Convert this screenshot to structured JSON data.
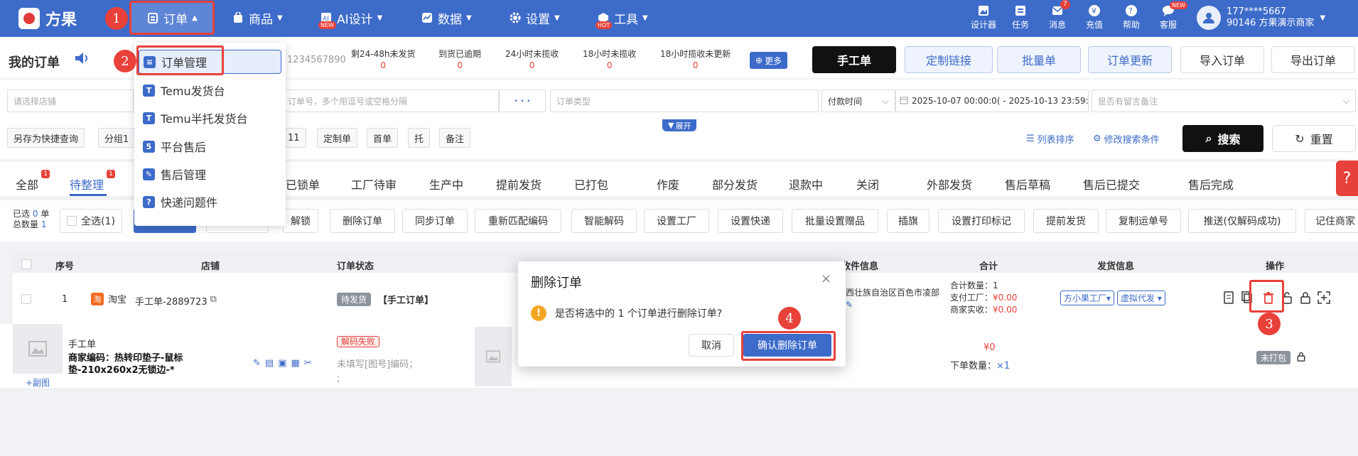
{
  "topnav": {
    "logo_text": "方果",
    "items": [
      {
        "label": "订单",
        "icon": "clipboard-icon"
      },
      {
        "label": "商品",
        "icon": "bag-icon"
      },
      {
        "label": "AI设计",
        "icon": "ai-icon",
        "badge": "NEW"
      },
      {
        "label": "数据",
        "icon": "chart-icon"
      },
      {
        "label": "设置",
        "icon": "gear-icon"
      },
      {
        "label": "工具",
        "icon": "toolbox-icon",
        "badge": "HOT"
      }
    ],
    "right_tools": [
      {
        "label": "设计器",
        "icon": "image-icon"
      },
      {
        "label": "任务",
        "icon": "task-icon"
      },
      {
        "label": "消息",
        "icon": "bell-icon",
        "count": "7"
      },
      {
        "label": "充值",
        "icon": "yen-icon"
      },
      {
        "label": "帮助",
        "icon": "help-icon"
      },
      {
        "label": "客服",
        "icon": "chat-icon",
        "badge": "NEW"
      }
    ],
    "user_phone": "177****5667",
    "user_shop": "90146 方果演示商家"
  },
  "header": {
    "title": "我的订单",
    "search_fragment": "1234567890",
    "stats": [
      {
        "label": "剩24-48h未发货",
        "value": "0"
      },
      {
        "label": "到货已逾期",
        "value": "0"
      },
      {
        "label": "24小时未揽收",
        "value": "0"
      },
      {
        "label": "18小时未揽收",
        "value": "0"
      },
      {
        "label": "18小时揽收未更新",
        "value": "0"
      }
    ],
    "more_label": "更多",
    "buttons": [
      "手工单",
      "定制链接",
      "批量单",
      "订单更新",
      "导入订单",
      "导出订单"
    ]
  },
  "filters": {
    "shop_placeholder": "请选择店铺",
    "order_no_placeholder": "订单号，多个用逗号或空格分隔",
    "dots": "· · ·",
    "order_type_placeholder": "订单类型",
    "time_type": "付款时间",
    "date_range": "2025-10-07 00:00:0( - 2025-10-13 23:59:5",
    "remark_placeholder": "是否有留言备注",
    "expand_label": "展开",
    "save_quick": "另存为快捷查询",
    "chips": [
      "分组1",
      "11",
      "定制单",
      "首单",
      "托",
      "备注"
    ],
    "sort_label": "列表排序",
    "modify_label": "修改搜索条件",
    "search_label": "搜索",
    "reset_label": "重置"
  },
  "tabs": [
    {
      "label": "全部",
      "badge": "1"
    },
    {
      "label": "待整理",
      "badge": "1"
    },
    {
      "label": "已锁单"
    },
    {
      "label": "工厂待审"
    },
    {
      "label": "生产中"
    },
    {
      "label": "提前发货"
    },
    {
      "label": "已打包"
    },
    {
      "label": "作废"
    },
    {
      "label": "部分发货"
    },
    {
      "label": "退款中"
    },
    {
      "label": "关闭"
    },
    {
      "label": "外部发货"
    },
    {
      "label": "售后草稿"
    },
    {
      "label": "售后已提交"
    },
    {
      "label": "售后完成"
    }
  ],
  "actions": {
    "selected_label": "已选",
    "selected_value": "0",
    "selected_unit": "单",
    "total_label": "总数量",
    "total_value": "1",
    "select_all": "全选(1)",
    "buttons": [
      "解锁",
      "删除订单",
      "同步订单",
      "重新匹配编码",
      "智能解码",
      "设置工厂",
      "设置快递",
      "批量设置赠品",
      "插旗",
      "设置打印标记",
      "提前发货",
      "复制运单号",
      "推送(仅解码成功)",
      "记住商家"
    ]
  },
  "table": {
    "headers": [
      "序号",
      "店铺",
      "订单状态",
      "收件信息",
      "合计",
      "发货信息",
      "操作"
    ],
    "row": {
      "index": "1",
      "platform": "淘宝",
      "order_no": "手工单-2889723",
      "status_pill": "待发货",
      "order_tag": "【手工订单】",
      "address": "西壮族自治区百色市凌部",
      "summary_qty_label": "合计数量：",
      "summary_qty": "1",
      "factory_pay_label": "支付工厂：",
      "factory_pay": "¥0.00",
      "merchant_label": "商家实收：",
      "merchant_recv": "¥0.00",
      "ship_factory": "方小果工厂",
      "ship_mode": "虚拟代发"
    },
    "product": {
      "name": "手工单",
      "merchant_code": "商家编码：热转印垫子-鼠标垫-210x260x2无锁边-*",
      "add_image": "+副图",
      "decode_pill": "解码失败",
      "code_hint": "未填写[图号]编码；",
      "code_hint2": ";",
      "price": "¥0",
      "order_qty_label": "下单数量：",
      "order_qty": "×1",
      "unpacked": "未打包"
    }
  },
  "dropdown": {
    "items": [
      {
        "label": "订单管理",
        "icon": "list-icon"
      },
      {
        "label": "Temu发货台",
        "icon": "temu-icon"
      },
      {
        "label": "Temu半托发货台",
        "icon": "temu-icon"
      },
      {
        "label": "平台售后",
        "icon": "aftersale-icon"
      },
      {
        "label": "售后管理",
        "icon": "edit-doc-icon"
      },
      {
        "label": "快递问题件",
        "icon": "question-icon"
      }
    ]
  },
  "dialog": {
    "title": "删除订单",
    "message": "是否将选中的 1 个订单进行删除订单?",
    "cancel_label": "取消",
    "confirm_label": "确认删除订单"
  },
  "steps": [
    "1",
    "2",
    "3",
    "4"
  ],
  "colors": {
    "primary": "#3d6bc9",
    "accent_red": "#e8413a",
    "dark_button": "#111111"
  }
}
